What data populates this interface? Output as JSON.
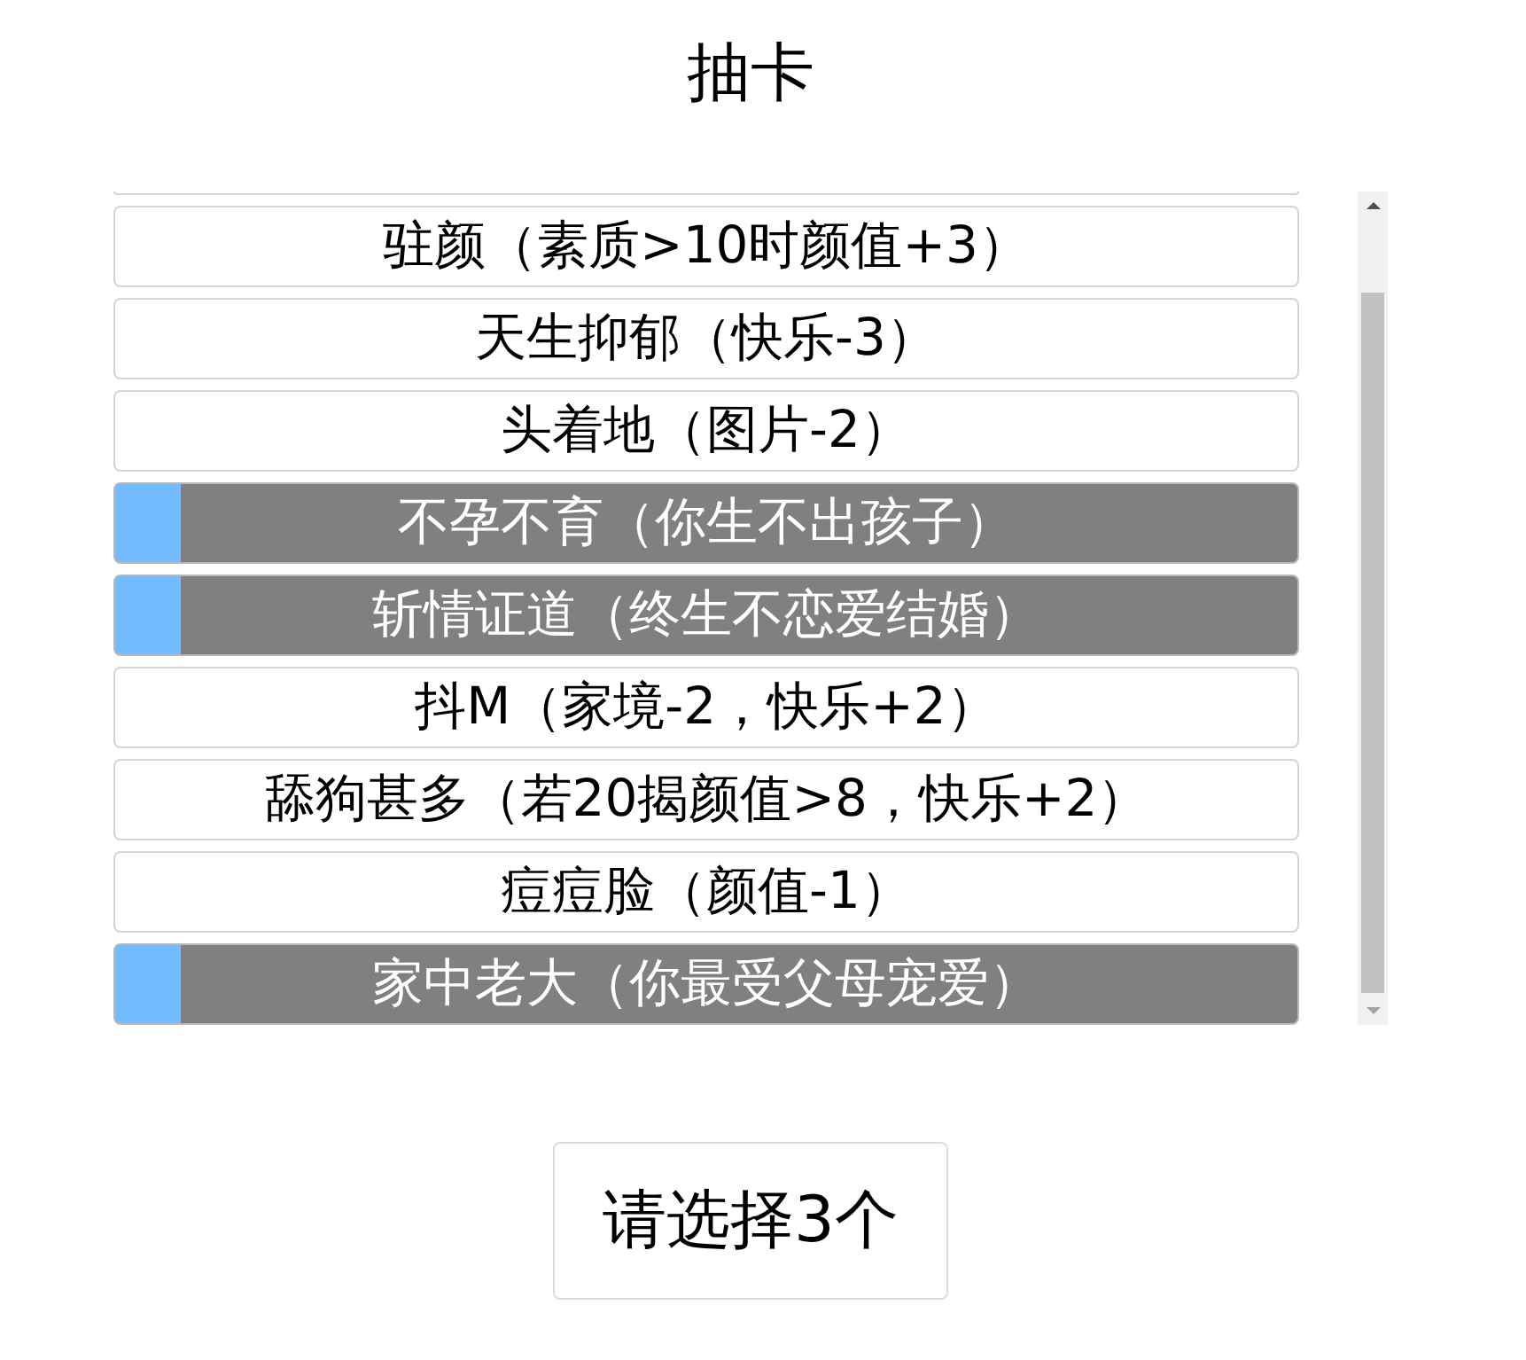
{
  "title": "抽卡",
  "talents": [
    {
      "label": "驻颜（素质>10时颜值+3）",
      "selected": false
    },
    {
      "label": "天生抑郁（快乐-3）",
      "selected": false
    },
    {
      "label": "头着地（图片-2）",
      "selected": false
    },
    {
      "label": "不孕不育（你生不出孩子）",
      "selected": true
    },
    {
      "label": "斩情证道（终生不恋爱结婚）",
      "selected": true
    },
    {
      "label": "抖M（家境-2，快乐+2）",
      "selected": false
    },
    {
      "label": "舔狗甚多（若20揭颜值>8，快乐+2）",
      "selected": false
    },
    {
      "label": "痘痘脸（颜值-1）",
      "selected": false
    },
    {
      "label": "家中老大（你最受父母宠爱）",
      "selected": true
    }
  ],
  "confirm_button": "请选择3个"
}
